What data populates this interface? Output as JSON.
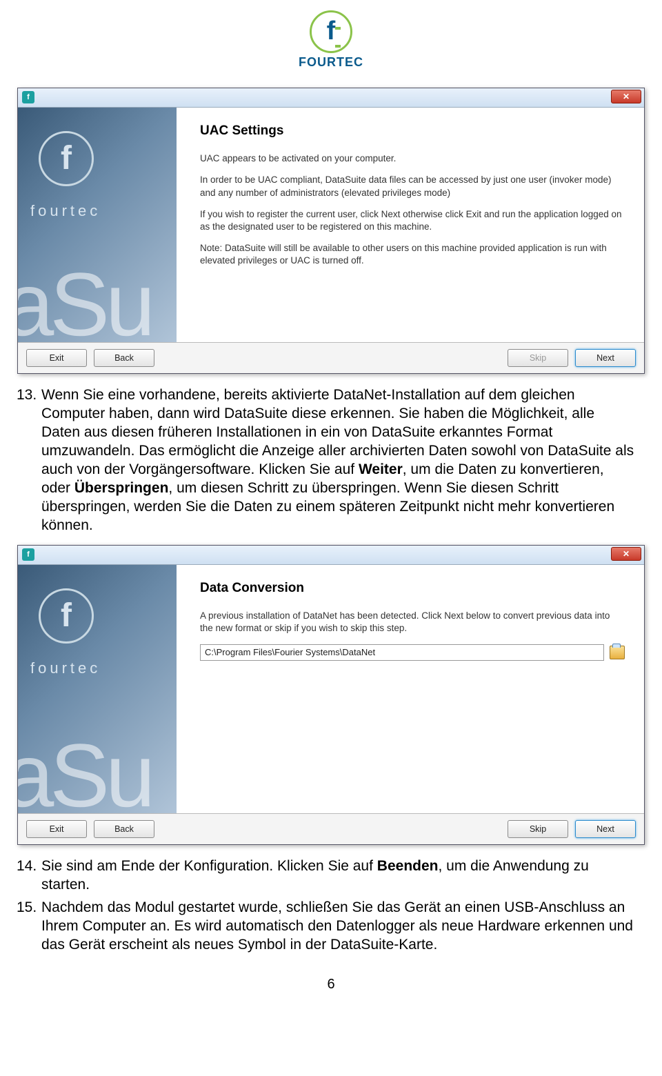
{
  "brand": {
    "name": "FOURTEC",
    "left_label": "fourtec",
    "left_big": "aSu"
  },
  "dialog1": {
    "heading": "UAC Settings",
    "p1": "UAC appears to be activated on your computer.",
    "p2": "In order to be UAC compliant, DataSuite data files can be accessed by just one user (invoker mode) and any number of administrators (elevated privileges mode)",
    "p3": "If you wish to register the current user, click Next  otherwise click Exit and run the application logged on as the designated user to be registered on this machine.",
    "p4": "Note: DataSuite will still be available to other users on this machine provided application is run with elevated privileges or UAC is turned off.",
    "buttons": {
      "exit": "Exit",
      "back": "Back",
      "skip": "Skip",
      "next": "Next"
    }
  },
  "para13": {
    "num": "13.",
    "text_a": "Wenn Sie eine vorhandene, bereits aktivierte DataNet-Installation auf dem gleichen Computer haben, dann wird DataSuite diese erkennen. Sie haben die Möglichkeit, alle Daten aus diesen früheren Installationen in ein von DataSuite erkanntes Format umzuwandeln. Das ermöglicht die Anzeige aller archivierten Daten sowohl von DataSuite als auch von der Vorgängersoftware. Klicken Sie auf ",
    "bold1": "Weiter",
    "text_b": ", um die Daten zu konvertieren, oder ",
    "bold2": "Überspringen",
    "text_c": ", um diesen Schritt zu überspringen. Wenn Sie diesen Schritt überspringen, werden Sie die Daten zu einem späteren Zeitpunkt nicht mehr konvertieren können."
  },
  "dialog2": {
    "heading": "Data Conversion",
    "p1": "A previous installation of DataNet has been detected. Click Next below to convert previous data into the new format or skip if you wish to skip this step.",
    "path": "C:\\Program Files\\Fourier Systems\\DataNet",
    "buttons": {
      "exit": "Exit",
      "back": "Back",
      "skip": "Skip",
      "next": "Next"
    }
  },
  "para14": {
    "num": "14.",
    "text_a": "Sie sind am Ende der Konfiguration. Klicken Sie auf ",
    "bold1": "Beenden",
    "text_b": ", um die Anwendung zu starten."
  },
  "para15": {
    "num": "15.",
    "text": "Nachdem das Modul gestartet wurde, schließen Sie das Gerät an einen USB-Anschluss an Ihrem Computer an. Es wird automatisch den Datenlogger als neue Hardware erkennen und das Gerät erscheint als neues Symbol in der DataSuite-Karte."
  },
  "page_number": "6"
}
